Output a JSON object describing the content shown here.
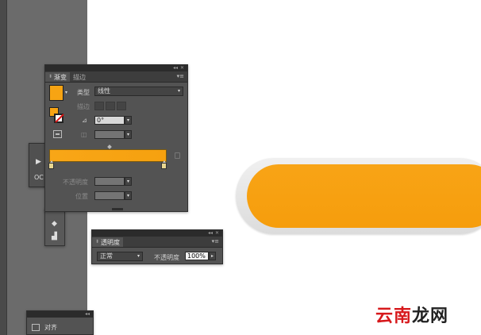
{
  "gradient_panel": {
    "tabs": [
      "渐变",
      "描边"
    ],
    "type_label": "类型",
    "type_value": "线性",
    "stroke_label": "描边",
    "angle_value": "0°",
    "aspect_label": "",
    "opacity_label": "不透明度",
    "position_label": "位置",
    "gradient": {
      "start_color": "#f8a617",
      "end_color": "#f6a10f"
    }
  },
  "transparency_panel": {
    "tab": "透明度",
    "blend_mode": "正常",
    "opacity_label": "不透明度",
    "opacity_value": "100%"
  },
  "align_panel": {
    "label": "对齐"
  },
  "tools": {
    "co_label": "OC"
  },
  "canvas": {
    "pill_color": "#f7a213"
  },
  "watermark": {
    "red": "云南",
    "black": "龙网"
  }
}
